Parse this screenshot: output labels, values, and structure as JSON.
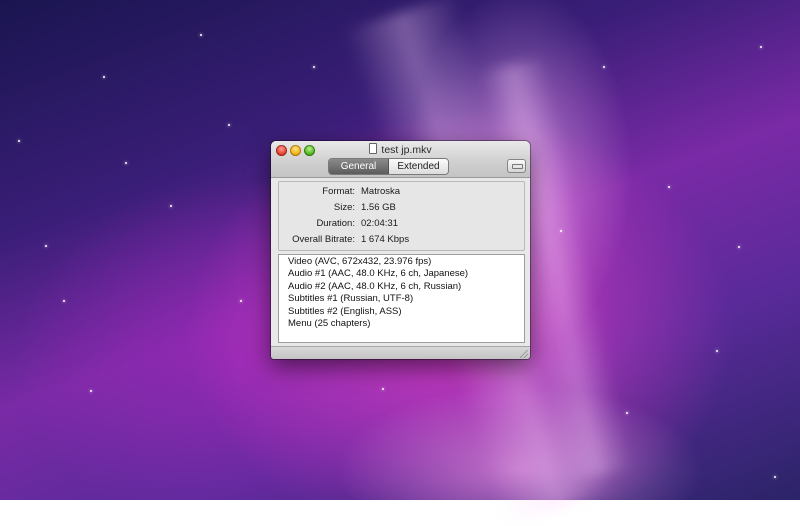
{
  "window": {
    "title": "test jp.mkv"
  },
  "tabs": {
    "general": "General",
    "extended": "Extended"
  },
  "info": {
    "format_label": "Format:",
    "format_value": "Matroska",
    "size_label": "Size:",
    "size_value": "1.56 GB",
    "duration_label": "Duration:",
    "duration_value": "02:04:31",
    "bitrate_label": "Overall Bitrate:",
    "bitrate_value": "1 674 Kbps"
  },
  "streams": [
    "Video (AVC, 672x432, 23.976 fps)",
    "Audio #1 (AAC, 48.0 KHz, 6 ch, Japanese)",
    "Audio #2 (AAC, 48.0 KHz, 6 ch, Russian)",
    "Subtitles #1 (Russian, UTF-8)",
    "Subtitles #2 (English, ASS)",
    "Menu (25 chapters)"
  ],
  "icons": {
    "close": "close-button",
    "minimize": "minimize-button",
    "zoom": "zoom-button",
    "file": "file-icon",
    "toolbar_toggle": "toolbar-toggle-button",
    "resize": "resize-grip-icon"
  },
  "colors": {
    "desktop_primary": "#7a2aa6",
    "desktop_glow": "#e13cc8",
    "window_bg": "#e8e8e8",
    "active_tab": "#5c5c5c"
  }
}
